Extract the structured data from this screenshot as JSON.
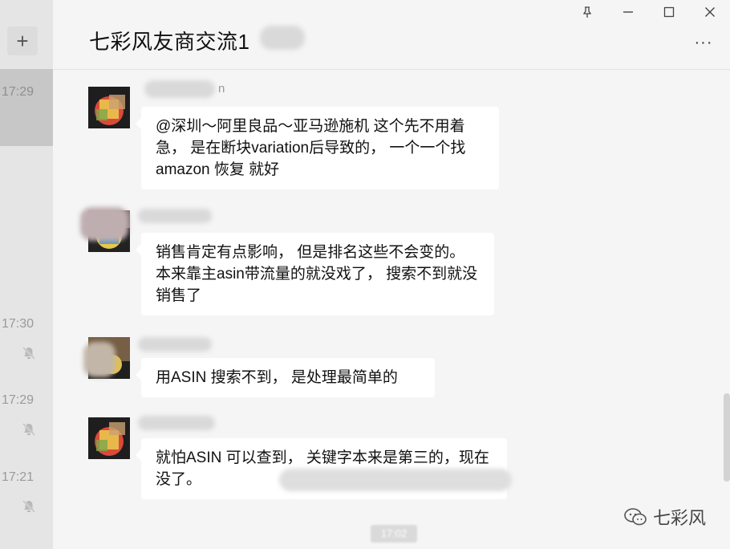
{
  "sidebar": {
    "add_label": "+",
    "items": [
      {
        "time": "17:29",
        "selected": true,
        "muted": false
      },
      {
        "time": "17:30",
        "selected": false,
        "muted": true
      },
      {
        "time": "17:29",
        "selected": false,
        "muted": true
      },
      {
        "time": "17:21",
        "selected": false,
        "muted": true
      }
    ]
  },
  "window": {
    "pin_label": "ꕤ",
    "minimize_label": "—",
    "maximize_label": "☐",
    "close_label": "✕"
  },
  "header": {
    "title": "七彩风友商交流1",
    "more_label": "···"
  },
  "messages": [
    {
      "sender_partial": "n",
      "text": "@深圳～阿里良品～亚马逊施机 这个先不用着急， 是在断块variation后导致的， 一个一个找amazon 恢复 就好"
    },
    {
      "sender_partial": "",
      "text": "销售肯定有点影响， 但是排名这些不会变的。 本来靠主asin带流量的就没戏了， 搜索不到就没销售了"
    },
    {
      "sender_partial": "",
      "text": "用ASIN 搜索不到， 是处理最简单的"
    },
    {
      "sender_partial": "",
      "text": "就怕ASIN 可以查到， 关键字本来是第三的，现在没了。"
    }
  ],
  "watermark": {
    "text": "七彩风"
  },
  "bottom_timestamp": "17:02"
}
